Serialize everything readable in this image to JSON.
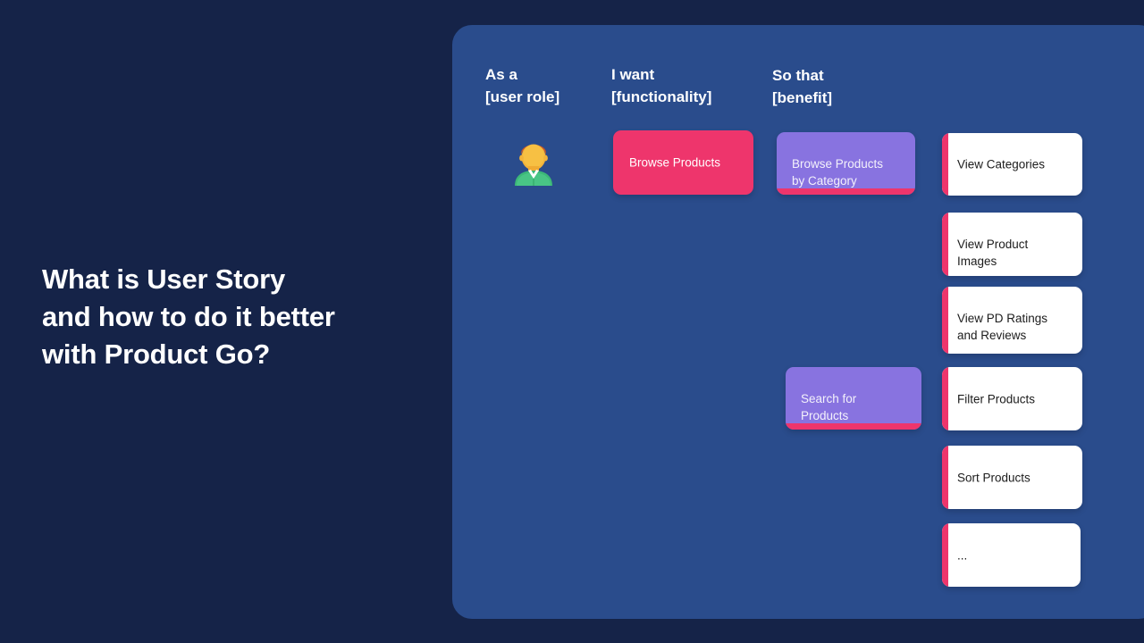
{
  "slide": {
    "background_color": "#152348",
    "panel_color": "#2a4c8c",
    "accent_pink": "#ee356c",
    "accent_purple": "#8873e0"
  },
  "title": {
    "line1": "What is User Story",
    "line2": "and how to do it better",
    "line3": "with Product Go?"
  },
  "columns": [
    {
      "label": "As a\n[user role]"
    },
    {
      "label": "I want\n[functionality]"
    },
    {
      "label": "So that\n[benefit]"
    }
  ],
  "persona": {
    "icon": "user-avatar-icon"
  },
  "functionality_cards": [
    {
      "label": "Browse Products"
    }
  ],
  "benefit_cards": [
    {
      "label": "Browse Products\nby Category"
    },
    {
      "label": "Search for\nProducts"
    }
  ],
  "detail_cards": [
    {
      "label": "View Categories"
    },
    {
      "label": "View Product\nImages"
    },
    {
      "label": "View PD Ratings\nand Reviews"
    },
    {
      "label": "Filter Products"
    },
    {
      "label": "Sort Products"
    },
    {
      "label": "..."
    }
  ]
}
